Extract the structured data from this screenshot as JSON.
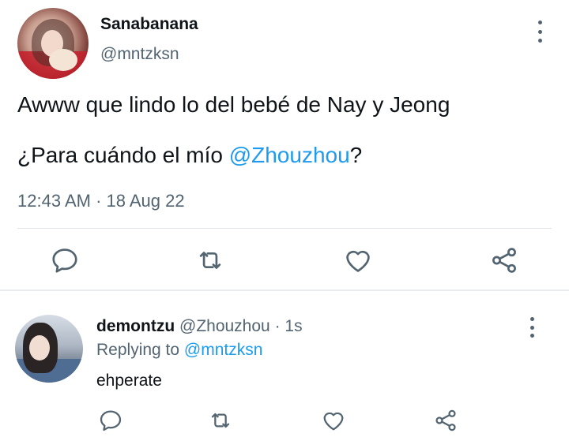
{
  "main_tweet": {
    "display_name": "Sanabanana",
    "handle": "@mntzksn",
    "text_line1": "Awww que lindo lo del bebé de Nay y Jeong",
    "text_line2_prefix": "¿Para cuándo el mío ",
    "text_line2_mention": "@Zhouzhou",
    "text_line2_suffix": "?",
    "timestamp": "12:43 AM · 18 Aug 22",
    "actions": [
      "reply-icon",
      "retweet-icon",
      "like-icon",
      "share-icon"
    ]
  },
  "reply_tweet": {
    "display_name": "demontzu",
    "handle": "@Zhouzhou",
    "separator": "·",
    "time": "1s",
    "replying_label": "Replying to ",
    "replying_handle": "@mntzksn",
    "text": "ehperate",
    "actions": [
      "reply-icon",
      "retweet-icon",
      "like-icon",
      "share-icon"
    ]
  },
  "colors": {
    "accent": "#1d9bf0",
    "text_primary": "#0f1419",
    "text_secondary": "#536471",
    "icon": "#536471",
    "divider": "#e2e6ea"
  }
}
